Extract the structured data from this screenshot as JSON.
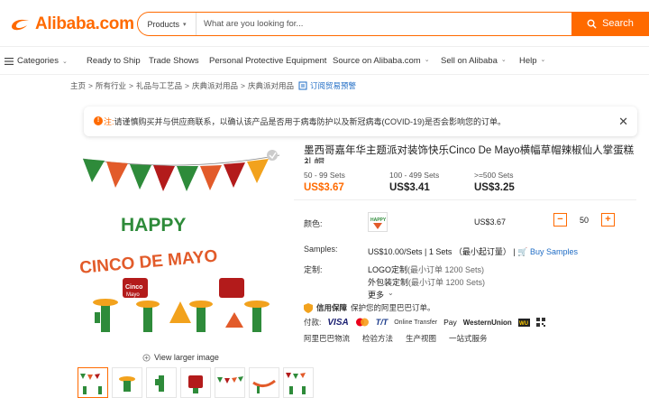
{
  "header": {
    "logo_text": "Alibaba.com",
    "search_category": "Products",
    "search_placeholder": "What are you looking for...",
    "search_button": "Search"
  },
  "nav": {
    "categories": "Categories",
    "items": [
      "Ready to Ship",
      "Trade Shows",
      "Personal Protective Equipment",
      "Source on Alibaba.com",
      "Sell on Alibaba",
      "Help"
    ]
  },
  "breadcrumb": {
    "items": [
      "主页",
      "所有行业",
      "礼品与工艺品",
      "庆典派对用品",
      "庆典派对用品"
    ],
    "separator": ">",
    "trade_alert": "订阅贸易预警"
  },
  "notice": {
    "icon_label": "!",
    "prefix": "注:",
    "text": "请谨慎购买并与供应商联系，以确认该产品是否用于病毒防护以及新冠病毒(COVID-19)是否会影响您的订单。"
  },
  "product": {
    "title": "墨西哥嘉年华主题派对装饰快乐Cinco De Mayo横幅草帽辣椒仙人掌蛋糕礼帽",
    "view_larger": "View larger image",
    "banner_line1": "HAPPY",
    "banner_line2": "CINCO DE MAYO",
    "topper_text_a": "Cinco",
    "topper_text_b": "Mayo",
    "swatch_text": "HAPPY"
  },
  "pricing": {
    "tiers": [
      {
        "qty": "50 - 99 Sets",
        "price": "US$3.67"
      },
      {
        "qty": "100 - 499 Sets",
        "price": "US$3.41"
      },
      {
        "qty": ">=500 Sets",
        "price": "US$3.25"
      }
    ]
  },
  "options": {
    "color_label": "颜色:",
    "unit_price": "US$3.67",
    "quantity": "50",
    "minus": "−",
    "plus": "+"
  },
  "samples": {
    "label": "Samples:",
    "text": "US$10.00/Sets | 1 Sets （最小起订量） |",
    "link": "Buy Samples"
  },
  "customization": {
    "label": "定制:",
    "logo": "LOGO定制",
    "logo_min": "(最小订单 1200 Sets)",
    "packaging": "外包装定制",
    "packaging_min": "(最小订单 1200 Sets)",
    "more": "更多"
  },
  "trade": {
    "title": "信用保障",
    "text": "保护您的阿里巴巴订单。"
  },
  "payment": {
    "label": "付款:",
    "visa": "VISA",
    "tt": "T/T",
    "online": "Online Transfer",
    "apple": "Pay",
    "wu": "WesternUnion"
  },
  "services": [
    "阿里巴巴物流",
    "检验方法",
    "生产视图",
    "一站式服务"
  ],
  "colors": {
    "accent": "#ff6a00",
    "link": "#1f6cc5"
  }
}
